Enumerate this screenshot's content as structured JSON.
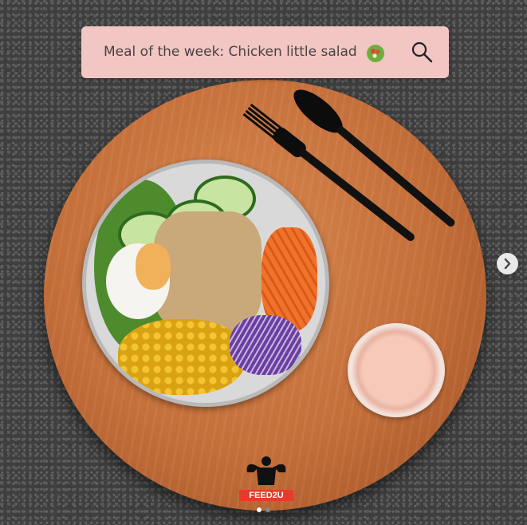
{
  "post": {
    "search_text": "Meal of the week: Chicken little salad",
    "search_emoji_icon": "salad-bowl-icon",
    "search_icon": "magnifier-icon",
    "brand_logo_text": "FEED2U",
    "next_icon": "chevron-right-icon"
  },
  "carousel": {
    "total_slides": 2,
    "active_slide": 1
  },
  "colors": {
    "search_bar": "#f1c6c3",
    "logo_red": "#e53a2c",
    "active_dot": "#ffffff",
    "inactive_dot": "#8a8a8a"
  }
}
